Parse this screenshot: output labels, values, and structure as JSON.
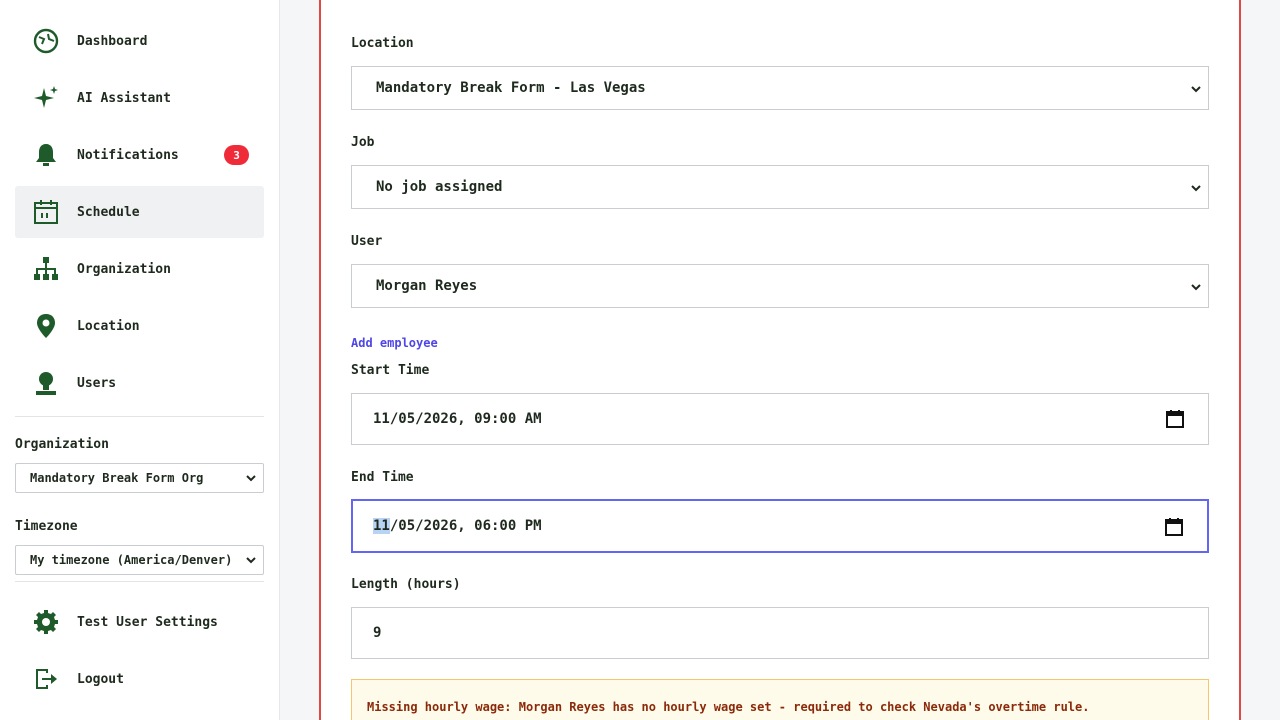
{
  "sidebar": {
    "nav": [
      {
        "label": "Dashboard",
        "icon": "dashboard-icon"
      },
      {
        "label": "AI Assistant",
        "icon": "sparkle-icon"
      },
      {
        "label": "Notifications",
        "icon": "bell-icon",
        "badge": "3"
      },
      {
        "label": "Schedule",
        "icon": "calendar-icon",
        "active": true
      },
      {
        "label": "Organization",
        "icon": "org-chart-icon"
      },
      {
        "label": "Location",
        "icon": "map-pin-icon"
      },
      {
        "label": "Users",
        "icon": "user-icon"
      }
    ],
    "organization_label": "Organization",
    "organization_value": "Mandatory Break Form Org",
    "timezone_label": "Timezone",
    "timezone_value": "My timezone (America/Denver)",
    "footer": [
      {
        "label": "Test User Settings",
        "icon": "gear-icon"
      },
      {
        "label": "Logout",
        "icon": "logout-icon"
      }
    ]
  },
  "form": {
    "location": {
      "label": "Location",
      "value": "Mandatory Break Form - Las Vegas"
    },
    "job": {
      "label": "Job",
      "value": "No job assigned"
    },
    "user": {
      "label": "User",
      "value": "Morgan Reyes"
    },
    "add_employee": "Add employee",
    "start_time": {
      "label": "Start Time",
      "value": "11/05/2026, 09:00 AM"
    },
    "end_time": {
      "label": "End Time",
      "value_highlight": "11",
      "value_rest": "/05/2026, 06:00 PM"
    },
    "length": {
      "label": "Length (hours)",
      "value": "9"
    },
    "warning": "Missing hourly wage: Morgan Reyes has no hourly wage set - required to check Nevada's overtime rule."
  },
  "colors": {
    "icon_green": "#1f5a2a",
    "badge_red": "#ef2b3a",
    "focus_indigo": "#6366f1",
    "panel_border": "#e04848",
    "link": "#4f46e5",
    "warning_text": "#8a2a0a"
  }
}
